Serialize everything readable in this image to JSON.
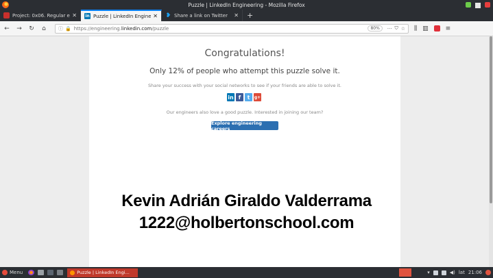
{
  "window": {
    "title": "Puzzle | LinkedIn Engineering - Mozilla Firefox"
  },
  "tabs": [
    {
      "label": "Project: 0x06. Regular ex",
      "icon": "project-icon",
      "active": false
    },
    {
      "label": "Puzzle | LinkedIn Enginee",
      "icon": "linkedin-icon",
      "active": true
    },
    {
      "label": "Share a link on Twitter",
      "icon": "twitter-icon",
      "active": false
    }
  ],
  "navbar": {
    "url_prefix": "https://engineering.",
    "url_domain": "linkedin.com",
    "url_path": "/puzzle",
    "zoom": "80%",
    "page_actions": "···"
  },
  "page": {
    "title": "Congratulations!",
    "solve_rate": "Only 12% of people who attempt this puzzle solve it.",
    "share_prompt": "Share your success with your social networks to see if your friends are able to solve it.",
    "socials": {
      "linkedin": "in",
      "facebook": "f",
      "twitter": "t",
      "googleplus": "g+"
    },
    "engineers_text": "Our engineers also love a good puzzle. Interested in joining our team?",
    "explore_button": "Explore engineering careers"
  },
  "overlay": {
    "name": "Kevin Adrián Giraldo Valderrama",
    "email": "1222@holbertonschool.com"
  },
  "taskbar": {
    "menu_label": "Menu",
    "window_label": "Puzzle | LinkedIn Engi...",
    "clock": "21:06",
    "lang": "lat"
  },
  "colors": {
    "accent": "#0a84ff",
    "explore_button": "#2c6fb1",
    "linkedin": "#0077b5",
    "facebook": "#3b5998",
    "twitter": "#55acee",
    "googleplus": "#dd4b39"
  }
}
